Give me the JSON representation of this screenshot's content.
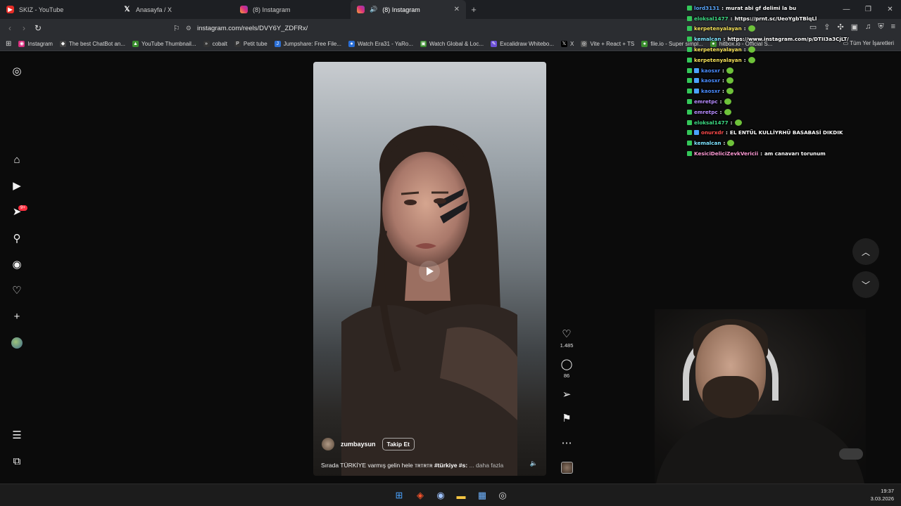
{
  "browser": {
    "tabs": [
      {
        "title": "SKIZ - YouTube",
        "icon": "youtube-icon"
      },
      {
        "title": "Anasayfa / X",
        "icon": "x-icon"
      },
      {
        "title": "(8) Instagram",
        "icon": "instagram-icon"
      },
      {
        "title": "(8) Instagram",
        "icon": "instagram-icon",
        "active": true
      }
    ],
    "url": "instagram.com/reels/DVY6Y_ZDFRx/",
    "bookmarks": [
      "Instagram",
      "The best ChatBot an...",
      "YouTube Thumbnail...",
      "cobalt",
      "Petit tube",
      "Jumpshare: Free File...",
      "Watch Era31 - YaRo...",
      "Watch Global & Loc...",
      "Excalidraw Whitebo...",
      "X",
      "Vite + React + TS",
      "file.io - Super simpl...",
      "hitbox.io - Official S..."
    ],
    "bookmarks_right": "Tüm Yer İşaretleri"
  },
  "instagram": {
    "notification_badge": "9+",
    "reel": {
      "username": "zumbaysun",
      "follow_label": "Takip Et",
      "caption_text": "Sırada TÜRKİYE varmış gelin hele ᴛʀᴛʀᴛʀ",
      "caption_tag": "#türkiye #s:",
      "caption_more": "... daha fazla"
    },
    "likes": "1.485",
    "comments": "86"
  },
  "chat": [
    {
      "user": "lord3131",
      "color": "#5aa8ff",
      "text": "murat abi gf delimi la bu"
    },
    {
      "user": "eloksal1477",
      "color": "#3ddc84",
      "text": "https://prnt.sc/UeoYgbTBlqLl"
    },
    {
      "user": "kerpetenyalayan",
      "color": "#f7e35a",
      "text": "",
      "emote": true
    },
    {
      "user": "kemalcan",
      "color": "#7ee3ff",
      "text": "https://www.instagram.com/p/DTII3a3CjLT/"
    },
    {
      "user": "kerpetenyalayan",
      "color": "#f7e35a",
      "text": "",
      "emote": true
    },
    {
      "user": "kerpetenyalayan",
      "color": "#f7e35a",
      "text": "",
      "emote": true
    },
    {
      "user": "kaosxr",
      "color": "#4a8cff",
      "text": "",
      "emote": true,
      "badge2": true
    },
    {
      "user": "kaosxr",
      "color": "#4a8cff",
      "text": "",
      "emote": true,
      "badge2": true
    },
    {
      "user": "kaosxr",
      "color": "#4a8cff",
      "text": "",
      "emote": true,
      "badge2": true
    },
    {
      "user": "emretpc",
      "color": "#b78bff",
      "text": "",
      "emote": true
    },
    {
      "user": "emretpc",
      "color": "#b78bff",
      "text": "",
      "emote": true
    },
    {
      "user": "eloksal1477",
      "color": "#3ddc84",
      "text": "",
      "emote": true
    },
    {
      "user": "onurxdr",
      "color": "#ff4b4b",
      "text": "EL ENTÜL KULLİYRHÜ BASABASİ DIKDIK",
      "badge2": true
    },
    {
      "user": "kemalcan",
      "color": "#7ee3ff",
      "text": "",
      "emote": true
    },
    {
      "user": "KesiciDeliciZevkVericii",
      "color": "#ff9ad5",
      "text": "am canavarı torunum"
    }
  ],
  "taskbar": {
    "time": "19:37",
    "date": "3.03.2026"
  }
}
